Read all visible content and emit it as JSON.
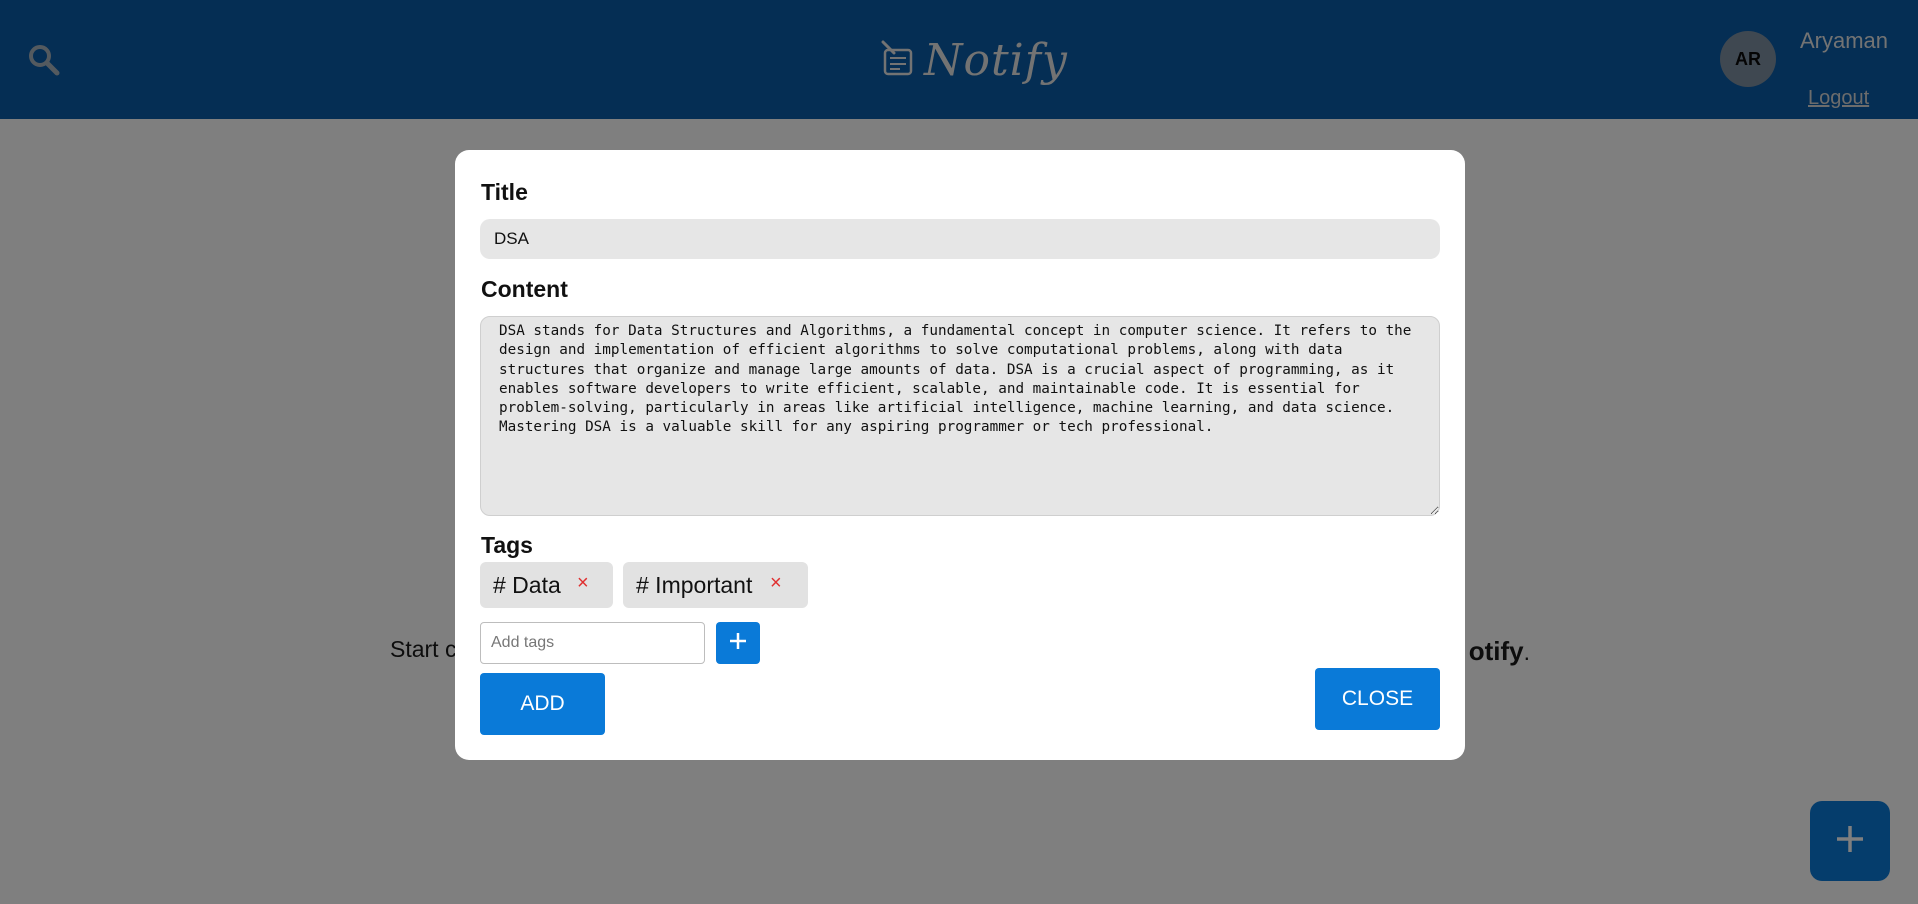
{
  "header": {
    "app_name": "Notify",
    "avatar_initials": "AR",
    "username": "Aryaman",
    "logout_label": "Logout"
  },
  "background": {
    "empty_message_start": "Start c",
    "empty_message_brand": "otify",
    "empty_message_end": "."
  },
  "modal": {
    "title_label": "Title",
    "title_value": "DSA",
    "content_label": "Content",
    "content_value": "DSA stands for Data Structures and Algorithms, a fundamental concept in computer science. It refers to the design and implementation of efficient algorithms to solve computational problems, along with data structures that organize and manage large amounts of data. DSA is a crucial aspect of programming, as it enables software developers to write efficient, scalable, and maintainable code. It is essential for problem-solving, particularly in areas like artificial intelligence, machine learning, and data science. Mastering DSA is a valuable skill for any aspiring programmer or tech professional.",
    "tags_label": "Tags",
    "tags": [
      "# Data",
      "# Important"
    ],
    "tag_remove_symbol": "×",
    "tag_input_placeholder": "Add tags",
    "add_button_label": "ADD",
    "close_button_label": "CLOSE"
  },
  "colors": {
    "header_bg": "#0a5ca8",
    "accent": "#0a7ad8",
    "tag_remove": "#e03030"
  },
  "icons": {
    "search": "search-icon",
    "logo": "note-icon",
    "tag_add": "plus-icon",
    "fab": "plus-icon"
  }
}
